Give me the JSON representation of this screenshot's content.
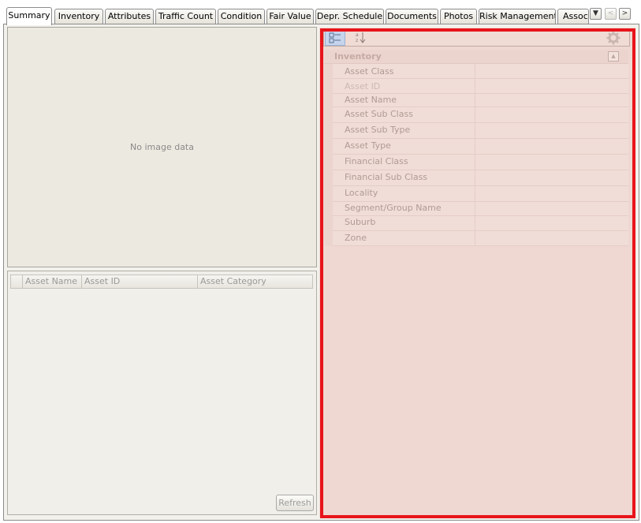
{
  "tabs": [
    {
      "label": "Summary",
      "active": true
    },
    {
      "label": "Inventory"
    },
    {
      "label": "Attributes"
    },
    {
      "label": "Traffic Count"
    },
    {
      "label": "Condition"
    },
    {
      "label": "Fair Value"
    },
    {
      "label": "Depr. Schedule"
    },
    {
      "label": "Documents"
    },
    {
      "label": "Photos"
    },
    {
      "label": "Risk Management"
    },
    {
      "label": "Associ"
    }
  ],
  "image_panel": {
    "placeholder": "No image data"
  },
  "grid": {
    "columns": [
      "Asset Name",
      "Asset ID",
      "Asset Category"
    ],
    "refresh_label": "Refresh"
  },
  "property_grid": {
    "category": "Inventory",
    "properties": [
      {
        "name": "Asset Class"
      },
      {
        "name": "Asset ID"
      },
      {
        "name": "Asset Name"
      },
      {
        "name": "Asset Sub Class"
      },
      {
        "name": "Asset Sub Type"
      },
      {
        "name": "Asset Type"
      },
      {
        "name": "Financial Class"
      },
      {
        "name": "Financial Sub Class"
      },
      {
        "name": "Locality"
      },
      {
        "name": "Segment/Group Name"
      },
      {
        "name": "Suburb"
      },
      {
        "name": "Zone"
      }
    ]
  },
  "colors": {
    "highlight": "#e8141a",
    "overlay": "#eed8d1"
  }
}
